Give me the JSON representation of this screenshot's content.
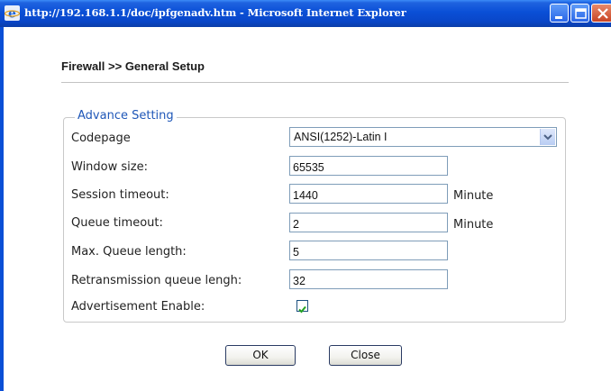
{
  "window": {
    "title": "http://192.168.1.1/doc/ipfgenadv.htm - Microsoft Internet Explorer",
    "title_bar_color": "#0a4fd6"
  },
  "page": {
    "title": "Firewall >> General Setup"
  },
  "advance_setting": {
    "legend": "Advance Setting",
    "legend_color": "#1f57b8",
    "codepage": {
      "label": "Codepage",
      "value": "ANSI(1252)-Latin I"
    },
    "window_size": {
      "label": "Window size:",
      "value": "65535"
    },
    "session_timeout": {
      "label": "Session timeout:",
      "value": "1440",
      "unit": "Minute"
    },
    "queue_timeout": {
      "label": "Queue timeout:",
      "value": "2",
      "unit": "Minute"
    },
    "max_queue_length": {
      "label": "Max. Queue length:",
      "value": "5"
    },
    "retransmission_queue_length": {
      "label": "Retransmission queue lengh:",
      "value": "32"
    },
    "advertisement_enable": {
      "label": "Advertisement Enable:",
      "checked": true
    }
  },
  "buttons": {
    "ok": "OK",
    "close": "Close"
  },
  "icons": {
    "app": "internet-explorer-icon",
    "minimize": "minimize-icon",
    "maximize": "maximize-icon",
    "close": "close-icon",
    "dropdown": "chevron-down-icon",
    "check": "checkmark-icon"
  }
}
